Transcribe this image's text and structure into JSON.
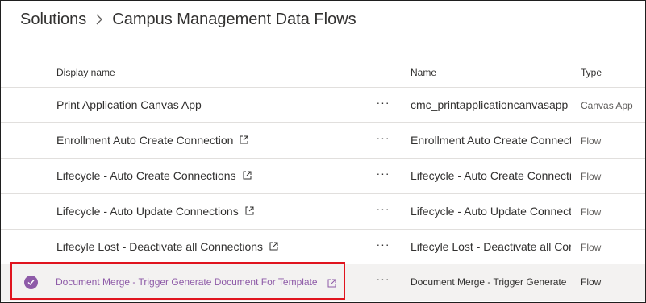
{
  "breadcrumb": {
    "root": "Solutions",
    "current": "Campus Management Data Flows"
  },
  "columns": {
    "display_name": "Display name",
    "name": "Name",
    "type": "Type"
  },
  "rows": [
    {
      "display_name": "Print Application Canvas App",
      "more": "···",
      "name": "cmc_printapplicationcanvasapp",
      "type": "Canvas App"
    },
    {
      "display_name": "Enrollment Auto Create Connection",
      "more": "···",
      "name": "Enrollment Auto Create Connect",
      "type": "Flow"
    },
    {
      "display_name": "Lifecycle - Auto Create Connections",
      "more": "···",
      "name": "Lifecycle - Auto Create Connectio",
      "type": "Flow"
    },
    {
      "display_name": "Lifecycle - Auto Update Connections",
      "more": "···",
      "name": "Lifecycle - Auto Update Connectio",
      "type": "Flow"
    },
    {
      "display_name": "Lifecyle Lost - Deactivate all Connections",
      "more": "···",
      "name": "Lifecyle Lost - Deactivate all Con",
      "type": "Flow"
    },
    {
      "display_name": "Document Merge - Trigger Generate Document For Template",
      "more": "···",
      "name": "Document Merge - Trigger Generate",
      "type": "Flow",
      "selected": true
    }
  ],
  "icons": {
    "breadcrumb_separator": "chevron-right-icon",
    "open_external": "open-in-new-window-icon",
    "selected": "checkmark-circle-icon",
    "more": "more-horizontal-icon"
  },
  "colors": {
    "accent": "#8e5ba8",
    "highlight_border": "#e0141e",
    "selected_row_bg": "#f3f2f1",
    "divider": "#e1dfdd"
  }
}
